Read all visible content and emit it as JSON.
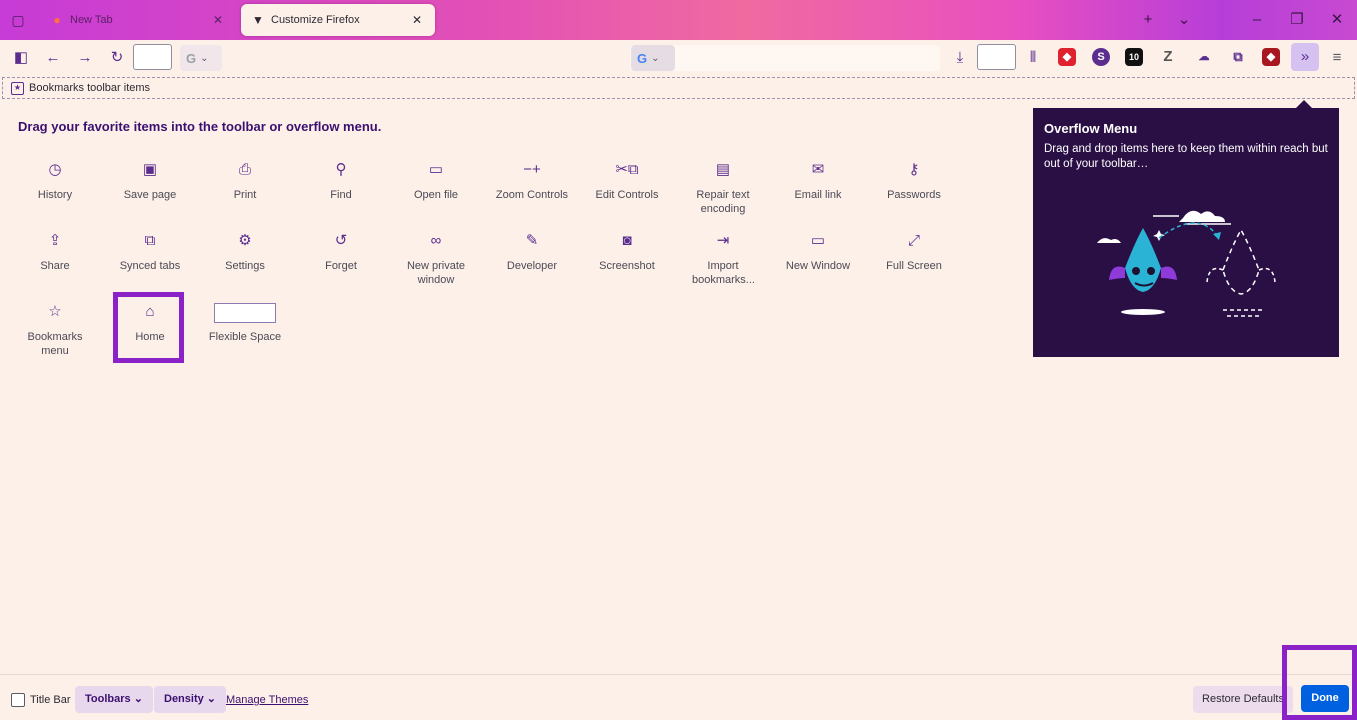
{
  "tabs": [
    {
      "label": "New Tab",
      "icon": "firefox-logo-icon",
      "active": false
    },
    {
      "label": "Customize Firefox",
      "icon": "customize-brush-icon",
      "active": true
    }
  ],
  "toolbar": {
    "extensions": [
      "ublock-icon",
      "s-extension-icon",
      "10-extension-icon",
      "z-extension-icon",
      "cloud-extension-icon",
      "puzzle-icon",
      "shield-extension-icon"
    ]
  },
  "bookmarks_toolbar": {
    "label": "Bookmarks toolbar items"
  },
  "palette": {
    "heading": "Drag your favorite items into the toolbar or overflow menu.",
    "items": [
      {
        "label": "History",
        "icon": "clock-icon"
      },
      {
        "label": "Save page",
        "icon": "save-page-icon"
      },
      {
        "label": "Print",
        "icon": "printer-icon"
      },
      {
        "label": "Find",
        "icon": "magnifier-icon"
      },
      {
        "label": "Open file",
        "icon": "open-file-icon"
      },
      {
        "label": "Zoom Controls",
        "icon": "zoom-controls-icon"
      },
      {
        "label": "Edit Controls",
        "icon": "edit-controls-icon"
      },
      {
        "label": "Repair text encoding",
        "icon": "text-encoding-icon"
      },
      {
        "label": "Email link",
        "icon": "envelope-icon"
      },
      {
        "label": "Passwords",
        "icon": "key-icon"
      },
      {
        "label": "Share",
        "icon": "share-icon"
      },
      {
        "label": "Synced tabs",
        "icon": "synced-tabs-icon"
      },
      {
        "label": "Settings",
        "icon": "gear-icon"
      },
      {
        "label": "Forget",
        "icon": "forget-icon"
      },
      {
        "label": "New private window",
        "icon": "mask-icon"
      },
      {
        "label": "Developer",
        "icon": "wrench-icon"
      },
      {
        "label": "Screenshot",
        "icon": "camera-icon"
      },
      {
        "label": "Import bookmarks...",
        "icon": "import-icon"
      },
      {
        "label": "New Window",
        "icon": "window-icon"
      },
      {
        "label": "Full Screen",
        "icon": "fullscreen-icon"
      },
      {
        "label": "Bookmarks menu",
        "icon": "bookmarks-menu-icon"
      },
      {
        "label": "Home",
        "icon": "home-icon"
      },
      {
        "label": "Flexible Space",
        "icon": "flexible-space-box"
      }
    ]
  },
  "overflow_menu": {
    "title": "Overflow Menu",
    "description": "Drag and drop items here to keep them within reach but out of your toolbar…"
  },
  "footer": {
    "title_bar_label": "Title Bar",
    "toolbars_label": "Toolbars",
    "density_label": "Density",
    "manage_themes_label": "Manage Themes",
    "restore_defaults_label": "Restore Defaults",
    "done_label": "Done"
  },
  "colors": {
    "accent": "#5b2d8f",
    "highlight": "#8a22c8",
    "done": "#0061e0",
    "panel": "#2a0f45"
  }
}
